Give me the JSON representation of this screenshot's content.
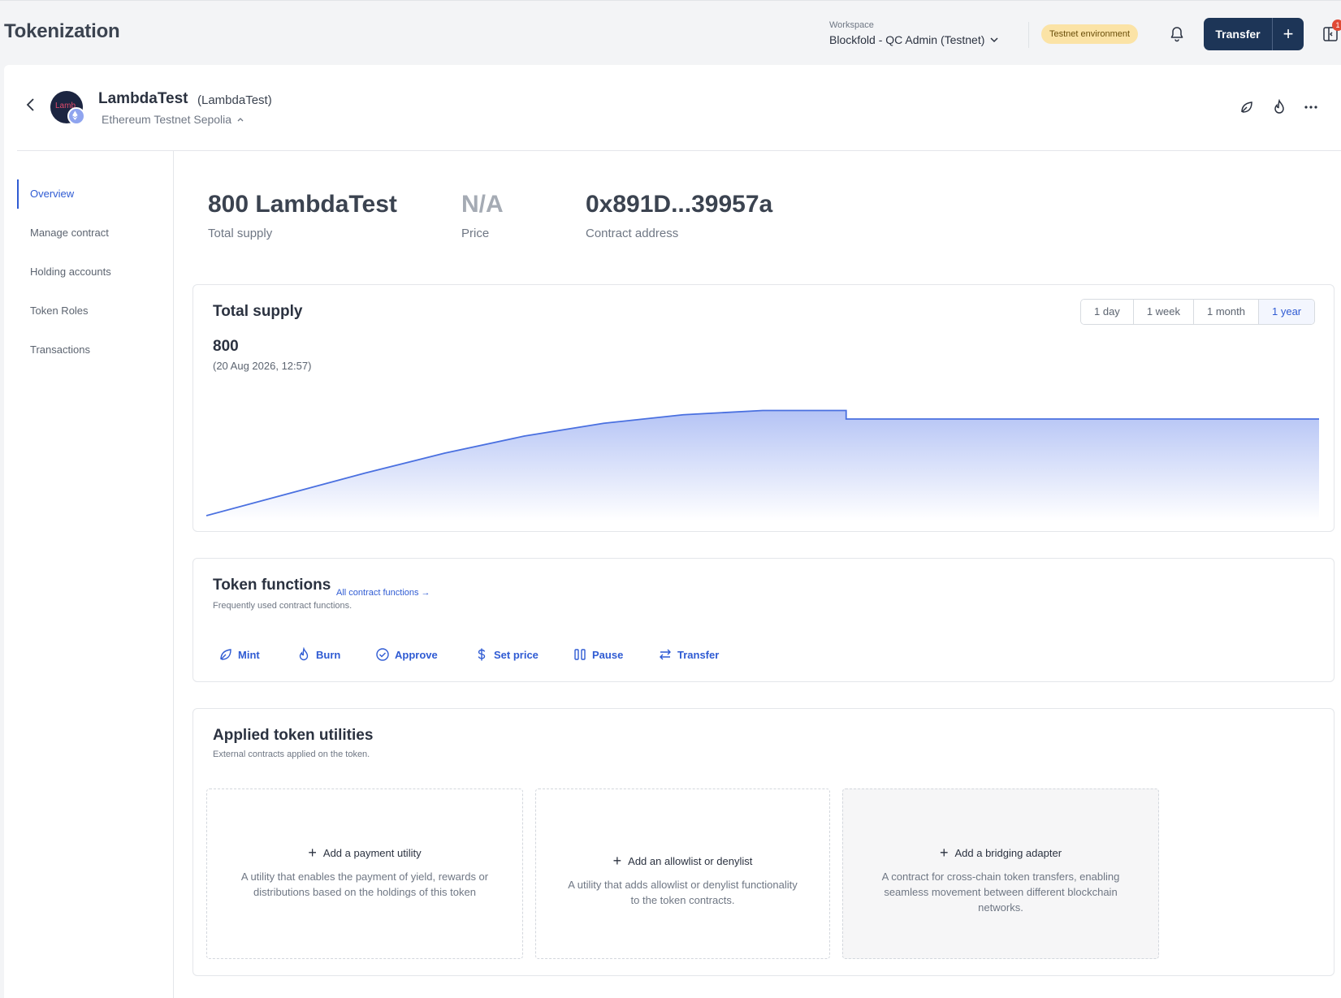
{
  "header": {
    "title": "Tokenization",
    "workspace_label": "Workspace",
    "workspace_value": "Blockfold - QC Admin (Testnet)",
    "environment_badge": "Testnet environment",
    "transfer_label": "Transfer",
    "notification_count": "1"
  },
  "token": {
    "avatar_text": "Lamb",
    "name": "LambdaTest",
    "symbol": "(LambdaTest)",
    "network": "Ethereum Testnet Sepolia"
  },
  "sidebar": {
    "items": [
      {
        "label": "Overview",
        "active": true
      },
      {
        "label": "Manage contract",
        "active": false
      },
      {
        "label": "Holding accounts",
        "active": false
      },
      {
        "label": "Token Roles",
        "active": false
      },
      {
        "label": "Transactions",
        "active": false
      }
    ]
  },
  "stats": {
    "supply_value": "800 LambdaTest",
    "supply_label": "Total supply",
    "price_value": "N/A",
    "price_label": "Price",
    "address_value": "0x891D...39957a",
    "address_label": "Contract address"
  },
  "supply_card": {
    "title": "Total supply",
    "ranges": [
      "1 day",
      "1 week",
      "1 month",
      "1 year"
    ],
    "active_range": "1 year",
    "current_value": "800",
    "current_date": "(20 Aug 2026, 12:57)"
  },
  "chart_data": {
    "type": "area",
    "title": "Total supply",
    "series": [
      {
        "values": [
          0,
          150,
          300,
          440,
          560,
          650,
          710,
          740,
          740,
          680,
          680,
          680,
          680,
          680,
          680
        ]
      }
    ],
    "step_drop_index": 9,
    "ylim": [
      0,
      800
    ],
    "grid": false,
    "color": "#4a70e0"
  },
  "functions_card": {
    "title": "Token functions",
    "link": "All contract functions →",
    "subtitle": "Frequently used contract functions.",
    "buttons": [
      "Mint",
      "Burn",
      "Approve",
      "Set price",
      "Pause",
      "Transfer"
    ]
  },
  "utilities_card": {
    "title": "Applied token utilities",
    "subtitle": "External contracts applied on the token.",
    "items": [
      {
        "label": "Add a payment utility",
        "desc": "A utility that enables the payment of yield, rewards or distributions based on the holdings of this token"
      },
      {
        "label": "Add an allowlist or denylist",
        "desc": "A utility that adds allowlist or denylist functionality to the token contracts."
      },
      {
        "label": "Add a bridging adapter",
        "desc": "A contract for cross-chain token transfers, enabling seamless movement between different blockchain networks."
      }
    ]
  },
  "colors": {
    "accent": "#2f5bd3",
    "primary_button": "#1d3557",
    "badge": "#fbe3a6"
  }
}
